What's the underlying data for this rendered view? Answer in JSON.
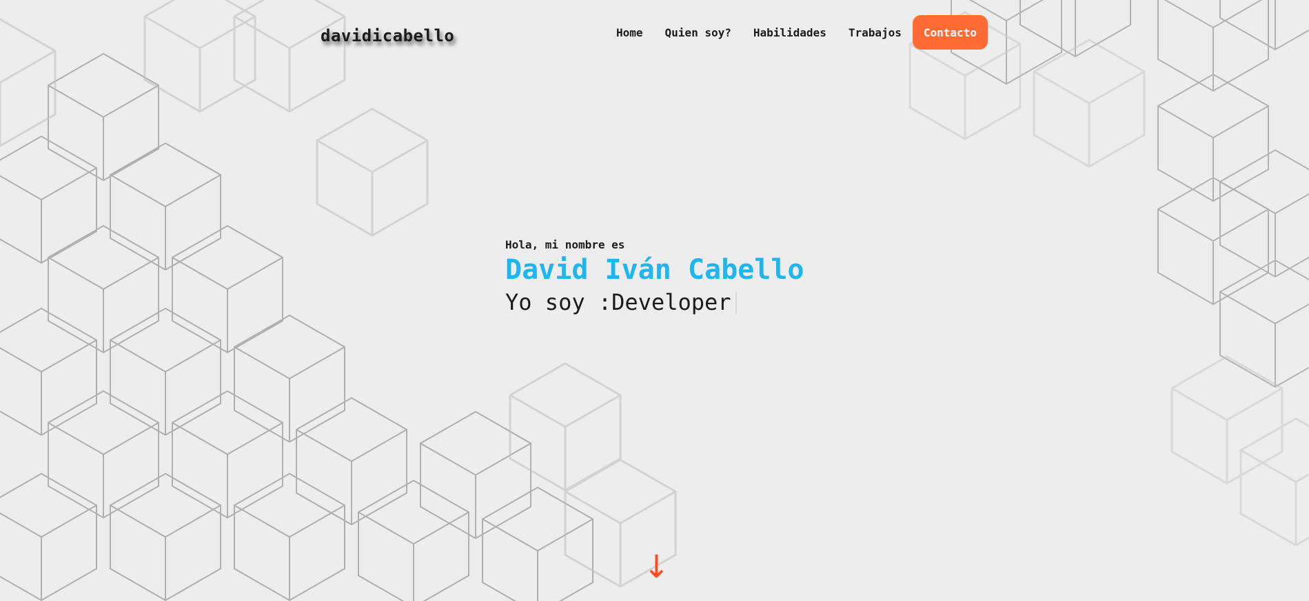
{
  "brand": {
    "logo_text": "davidicabello"
  },
  "nav": {
    "items": [
      {
        "label": "Home"
      },
      {
        "label": "Quien soy?"
      },
      {
        "label": "Habilidades"
      },
      {
        "label": "Trabajos"
      }
    ],
    "cta_label": "Contacto"
  },
  "hero": {
    "greeting": "Hola, mi nombre es",
    "name": "David Iván Cabello",
    "role_prefix": "Yo soy :",
    "role": "Developer"
  },
  "scroll": {
    "icon": "arrow-down-icon",
    "glyph": "↓"
  },
  "colors": {
    "background": "#ededed",
    "accent": "#ff6b35",
    "name": "#1fb6ef",
    "arrow": "#ff4b1f"
  }
}
